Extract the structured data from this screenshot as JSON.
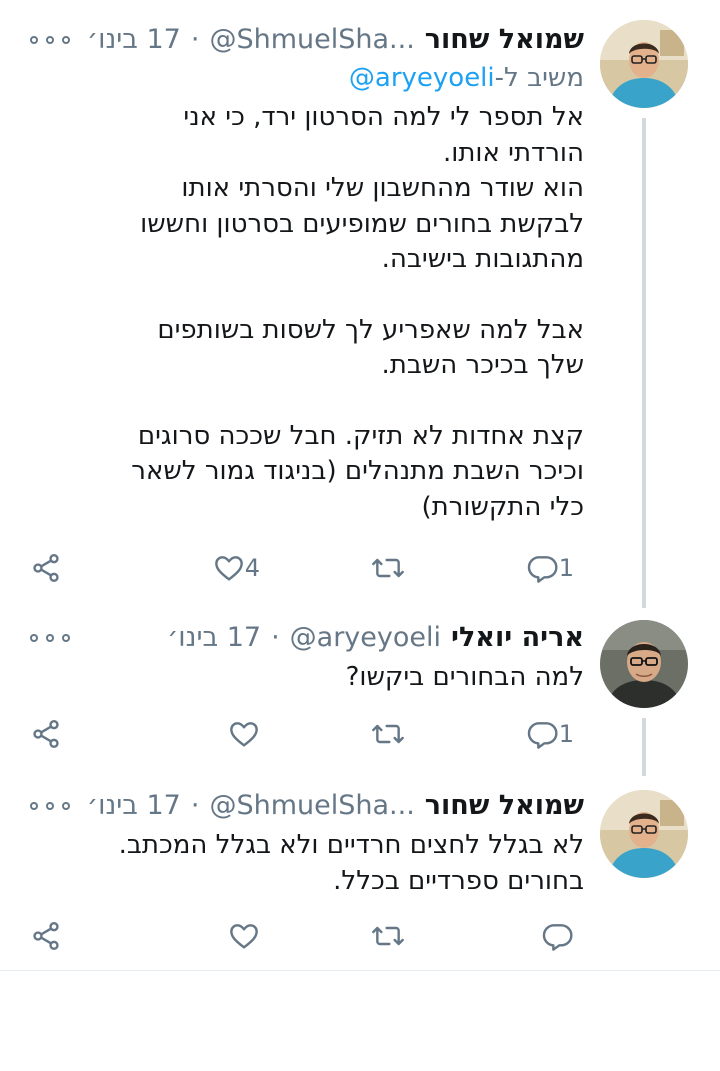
{
  "tweets": [
    {
      "display_name": "שמואל שחור",
      "handle": "@ShmuelSha...",
      "separator": "·",
      "date": "17 בינו׳",
      "reply_prefix": "משיב ל-",
      "reply_mention": "@aryeyoeli",
      "paragraphs": [
        "אל תספר לי למה הסרטון ירד, כי אני הורדתי אותו.\nהוא שודר מהחשבון שלי והסרתי אותו לבקשת בחורים שמופיעים בסרטון וחששו מהתגובות בישיבה.",
        "אבל למה שאפריע לך לשסות בשותפים שלך בכיכר השבת.",
        "קצת אחדות לא תזיק. חבל שככה סרוגים וכיכר השבת מתנהלים (בניגוד גמור לשאר כלי התקשורת)"
      ],
      "reply_count": "1",
      "retweet_count": "",
      "like_count": "4",
      "avatar_icon": "profile-photo"
    },
    {
      "display_name": "אריה יואלי",
      "handle": "@aryeyoeli",
      "separator": "·",
      "date": "17 בינו׳",
      "paragraphs": [
        "למה הבחורים ביקשו?"
      ],
      "reply_count": "1",
      "retweet_count": "",
      "like_count": "",
      "avatar_icon": "profile-photo"
    },
    {
      "display_name": "שמואל שחור",
      "handle": "@ShmuelSha...",
      "separator": "·",
      "date": "17 בינו׳",
      "paragraphs": [
        "לא בגלל לחצים חרדיים ולא בגלל המכתב.\nבחורים ספרדיים בכלל."
      ],
      "reply_count": "",
      "retweet_count": "",
      "like_count": "",
      "avatar_icon": "profile-photo"
    }
  ],
  "icons": {
    "reply": "reply-icon",
    "retweet": "retweet-icon",
    "like": "heart-icon",
    "share": "share-icon",
    "more": "more-icon"
  },
  "colors": {
    "text": "#14171a",
    "secondary": "#657786",
    "link": "#1da1f2",
    "thread_line": "#cfd9de",
    "divider": "#e6ecf0"
  }
}
